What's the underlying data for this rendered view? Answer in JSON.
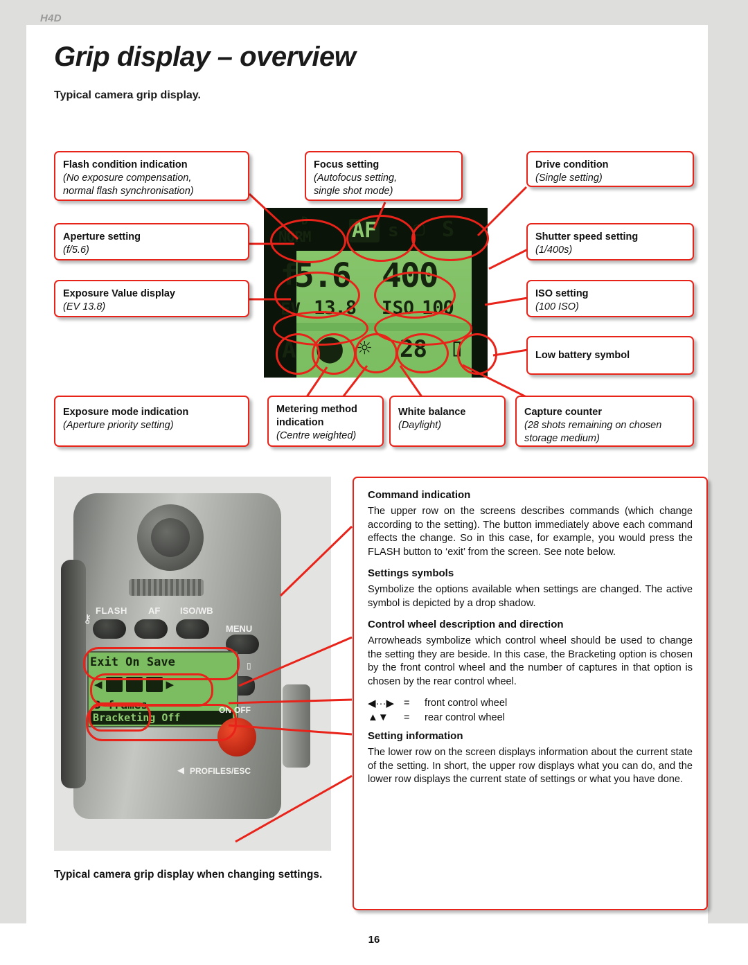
{
  "header": {
    "tag": "H4D",
    "title": "Grip display – overview",
    "subtitle": "Typical camera grip display."
  },
  "callouts": [
    {
      "name": "flash-condition",
      "title": "Flash condition indication",
      "sub": "(No exposure compensation,\nnormal flash synchronisation)"
    },
    {
      "name": "focus-setting",
      "title": "Focus setting",
      "sub": "(Autofocus setting,\nsingle shot mode)"
    },
    {
      "name": "drive-condition",
      "title": "Drive condition",
      "sub": "(Single setting)"
    },
    {
      "name": "aperture-setting",
      "title": "Aperture setting",
      "sub": "(f/5.6)"
    },
    {
      "name": "shutter-speed-setting",
      "title": "Shutter speed setting",
      "sub": "(1/400s)"
    },
    {
      "name": "exposure-value-display",
      "title": "Exposure Value display",
      "sub": "(EV 13.8)"
    },
    {
      "name": "iso-setting",
      "title": "ISO setting",
      "sub": "(100 ISO)"
    },
    {
      "name": "low-battery-symbol",
      "title": "Low battery symbol",
      "sub": ""
    },
    {
      "name": "exposure-mode-indication",
      "title": "Exposure mode indication",
      "sub": "(Aperture priority setting)"
    },
    {
      "name": "metering-method-indication",
      "title": "Metering method\nindication",
      "sub": "(Centre weighted)"
    },
    {
      "name": "white-balance",
      "title": "White balance",
      "sub": "(Daylight)"
    },
    {
      "name": "capture-counter",
      "title": "Capture counter",
      "sub": "(28 shots remaining on chosen\nstorage medium)"
    }
  ],
  "lcd": {
    "flash_mode": "NORM",
    "flash_d": "D",
    "focus": "AF",
    "focus_mode": "s",
    "drive": "S",
    "aperture": "5.6",
    "aperture_prefix": "f",
    "shutter": "400",
    "ev_label": "EV",
    "ev_value": "13.8",
    "iso_label": "ISO",
    "iso_value": "100",
    "exposure_mode": "A",
    "counter": "28"
  },
  "camera": {
    "flash_label": "FLASH",
    "af_label": "AF",
    "isowb_label": "ISO/WB",
    "menu_label": "MENU",
    "onoff_label": "ON·OFF",
    "profiles_label": "PROFILES/ESC",
    "screen_top": "Exit    On    Save",
    "screen_mid": "3 frames",
    "screen_bottom": "Bracketing Off"
  },
  "caption": "Typical camera grip display when changing settings.",
  "panel": {
    "sections": [
      {
        "heading": "Command indication",
        "body": "The upper row on the screens describes commands (which change according to the setting). The button immediately above each command effects the change. So in this case, for example, you would press the FLASH button to ‘exit’ from the screen. See note below."
      },
      {
        "heading": "Settings symbols",
        "body": "Symbolize the options available when settings are changed. The active symbol is depicted by a drop shadow."
      },
      {
        "heading": "Control wheel description and direction",
        "body": "Arrowheads symbolize which control wheel should be used to change the setting they are beside. In this case, the Bracketing option is chosen by the front control wheel and the number of captures in that option is chosen by the rear control wheel."
      }
    ],
    "wheels": [
      {
        "glyph": "◀···▶",
        "eq": "=",
        "label": "front control wheel"
      },
      {
        "glyph": "▲▼",
        "eq": "=",
        "label": "rear control wheel"
      }
    ],
    "final": {
      "heading": "Setting information",
      "body": "The lower row on the screen displays information about the current state of the setting. In short, the upper row displays what you can do, and the lower row displays the current state of settings or what you have done."
    }
  },
  "page_number": "16",
  "colors": {
    "accent": "#e8231a",
    "lcd_green": "#86c56b",
    "band": "#dededd"
  }
}
